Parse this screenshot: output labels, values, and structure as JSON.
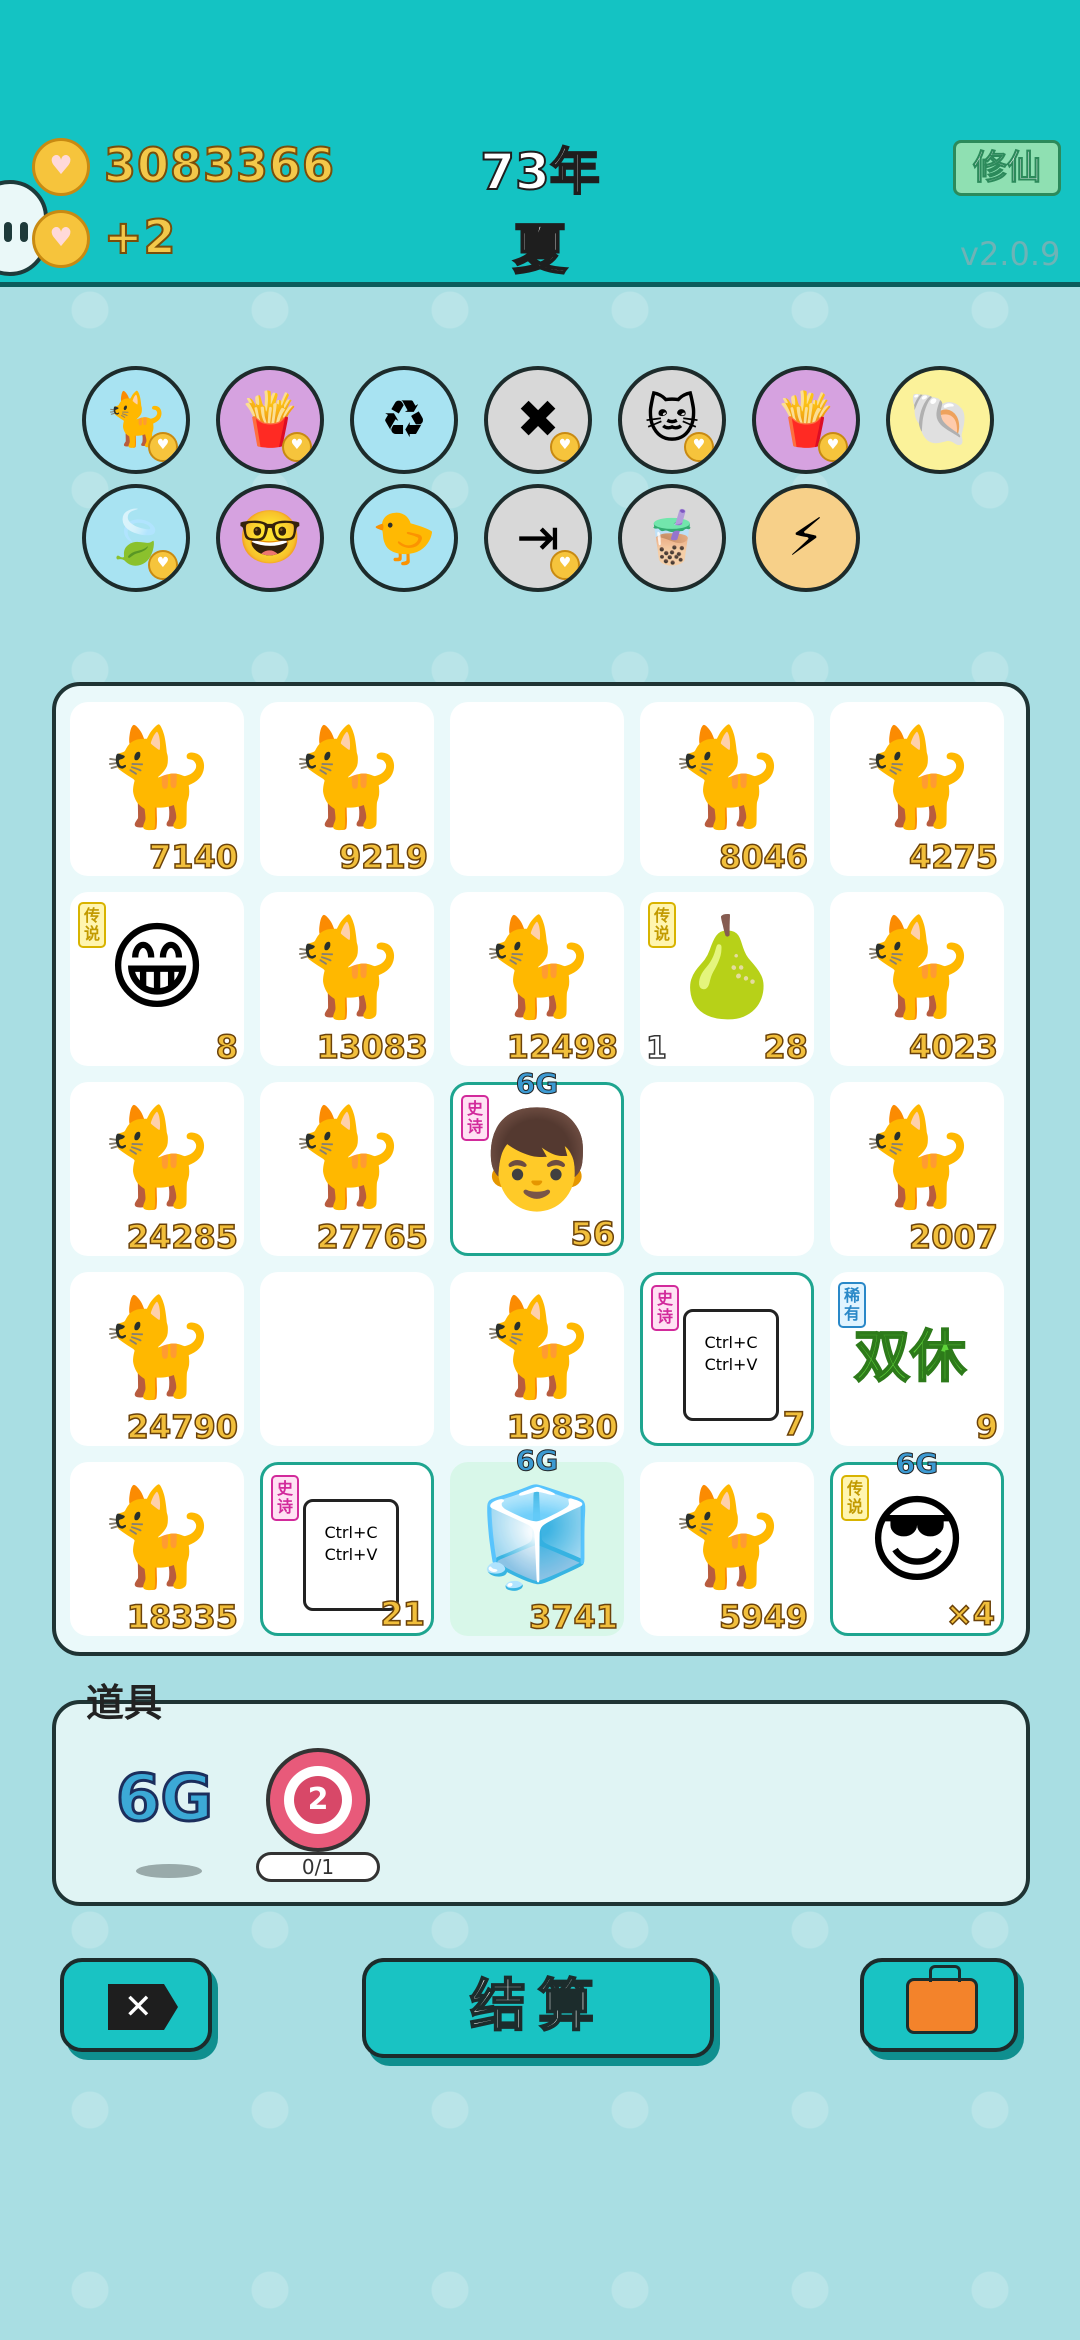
{
  "header": {
    "coins": "3083366",
    "coin_rate": "+2",
    "year": "73年",
    "season": "夏",
    "cultivate_label": "修仙",
    "version": "v2.0.9"
  },
  "buffs": [
    {
      "name": "cat-back",
      "glyph": "🐈",
      "bg": "#a8e3f2",
      "heart": true
    },
    {
      "name": "fries",
      "glyph": "🍟",
      "bg": "#d6a2e0",
      "heart": true
    },
    {
      "name": "recycle",
      "glyph": "♻",
      "bg": "#a8e3f2",
      "heart": false
    },
    {
      "name": "delete-tag",
      "glyph": "✖",
      "bg": "#d8d8d8",
      "heart": true
    },
    {
      "name": "owl-cats",
      "glyph": "🐱",
      "bg": "#d8d8d8",
      "heart": true
    },
    {
      "name": "fries-2",
      "glyph": "🍟",
      "bg": "#d6a2e0",
      "heart": true
    },
    {
      "name": "shell",
      "glyph": "🐚",
      "bg": "#fbf29a",
      "heart": false
    },
    {
      "name": "leaf",
      "glyph": "🍃",
      "bg": "#a8e3f2",
      "heart": true
    },
    {
      "name": "math-head",
      "glyph": "🤓",
      "bg": "#d6a2e0",
      "heart": false
    },
    {
      "name": "chick-egg",
      "glyph": "🐤",
      "bg": "#a8e3f2",
      "heart": false
    },
    {
      "name": "skip",
      "glyph": "⇥",
      "bg": "#d8d8d8",
      "heart": true
    },
    {
      "name": "bubble-tea",
      "glyph": "🧋",
      "bg": "#d8d8d8",
      "heart": false
    },
    {
      "name": "lightning",
      "glyph": "⚡",
      "bg": "#f7d089",
      "heart": false
    }
  ],
  "board": [
    [
      {
        "type": "cat",
        "num": "7140"
      },
      {
        "type": "cat",
        "num": "9219"
      },
      {
        "type": "empty"
      },
      {
        "type": "cat",
        "num": "8046"
      },
      {
        "type": "cat",
        "num": "4275"
      }
    ],
    [
      {
        "type": "legend-face",
        "num": "8",
        "rarity": "传说"
      },
      {
        "type": "cat",
        "num": "13083"
      },
      {
        "type": "cat",
        "num": "12498"
      },
      {
        "type": "legend-pear",
        "num": "28",
        "lvl": "1",
        "rarity": "传说"
      },
      {
        "type": "cat",
        "num": "4023"
      }
    ],
    [
      {
        "type": "cat",
        "num": "24285"
      },
      {
        "type": "cat",
        "num": "27765"
      },
      {
        "type": "boy",
        "num": "56",
        "rarity": "史诗",
        "tag": "6G"
      },
      {
        "type": "empty"
      },
      {
        "type": "cat",
        "num": "2007"
      }
    ],
    [
      {
        "type": "cat",
        "num": "24790"
      },
      {
        "type": "empty"
      },
      {
        "type": "cat",
        "num": "19830"
      },
      {
        "type": "copy",
        "num": "7",
        "rarity": "史诗"
      },
      {
        "type": "shuangxiu",
        "num": "9",
        "rarity": "稀有",
        "text": "双休"
      }
    ],
    [
      {
        "type": "cat",
        "num": "18335"
      },
      {
        "type": "copy",
        "num": "21",
        "rarity": "史诗"
      },
      {
        "type": "fridge",
        "num": "3741",
        "tag": "6G"
      },
      {
        "type": "cat",
        "num": "5949"
      },
      {
        "type": "glasses-man",
        "num": "×4",
        "rarity": "传说",
        "tag": "6G"
      }
    ]
  ],
  "copy_card": {
    "line1": "Ctrl+C",
    "line2": "Ctrl+V"
  },
  "items": {
    "label": "道具",
    "item1": "6G",
    "target_count": "2",
    "target_progress": "0/1"
  },
  "buttons": {
    "close_glyph": "✕",
    "settle_label": "结算"
  }
}
